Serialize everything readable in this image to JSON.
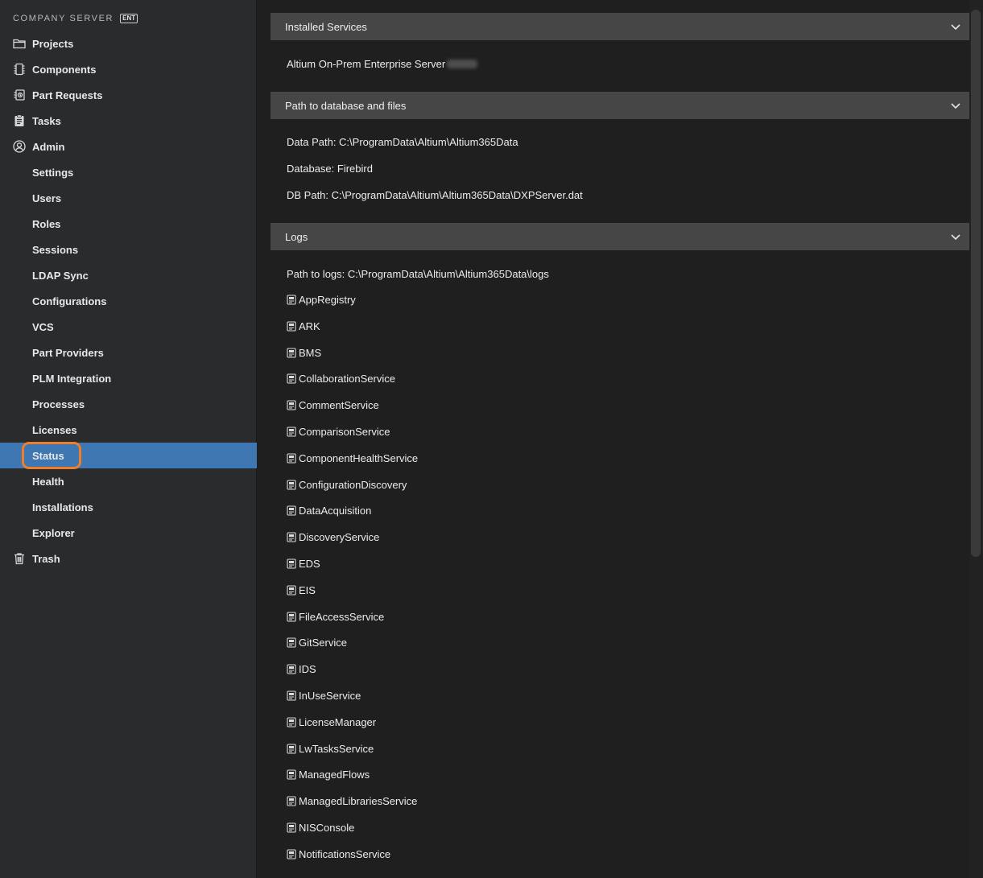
{
  "brand": {
    "name": "COMPANY SERVER",
    "badge": "ENT"
  },
  "sidebar": {
    "items": [
      {
        "label": "Projects",
        "icon": "folder-icon"
      },
      {
        "label": "Components",
        "icon": "chip-icon"
      },
      {
        "label": "Part Requests",
        "icon": "part-request-icon"
      },
      {
        "label": "Tasks",
        "icon": "clipboard-icon"
      },
      {
        "label": "Admin",
        "icon": "user-circle-icon"
      },
      {
        "label": "Settings"
      },
      {
        "label": "Users"
      },
      {
        "label": "Roles"
      },
      {
        "label": "Sessions"
      },
      {
        "label": "LDAP Sync"
      },
      {
        "label": "Configurations"
      },
      {
        "label": "VCS"
      },
      {
        "label": "Part Providers"
      },
      {
        "label": "PLM Integration"
      },
      {
        "label": "Processes"
      },
      {
        "label": "Licenses"
      },
      {
        "label": "Status",
        "active": true
      },
      {
        "label": "Health"
      },
      {
        "label": "Installations"
      },
      {
        "label": "Explorer"
      },
      {
        "label": "Trash",
        "icon": "trash-icon"
      }
    ]
  },
  "panels": {
    "installed": {
      "title": "Installed Services",
      "service": "Altium On-Prem Enterprise Server"
    },
    "paths": {
      "title": "Path to database and files",
      "data_path": "Data Path: C:\\ProgramData\\Altium\\Altium365Data",
      "database": "Database: Firebird",
      "db_path": "DB Path: C:\\ProgramData\\Altium\\Altium365Data\\DXPServer.dat"
    },
    "logs": {
      "title": "Logs",
      "path": "Path to logs: C:\\ProgramData\\Altium\\Altium365Data\\logs",
      "items": [
        "AppRegistry",
        "ARK",
        "BMS",
        "CollaborationService",
        "CommentService",
        "ComparisonService",
        "ComponentHealthService",
        "ConfigurationDiscovery",
        "DataAcquisition",
        "DiscoveryService",
        "EDS",
        "EIS",
        "FileAccessService",
        "GitService",
        "IDS",
        "InUseService",
        "LicenseManager",
        "LwTasksService",
        "ManagedFlows",
        "ManagedLibrariesService",
        "NISConsole",
        "NotificationsService"
      ]
    }
  },
  "colors": {
    "sidebar_bg": "#2a2b2d",
    "active_bg": "#3f77b2",
    "highlight_ring": "#ef7d2a",
    "panel_header_bg": "#464646"
  }
}
